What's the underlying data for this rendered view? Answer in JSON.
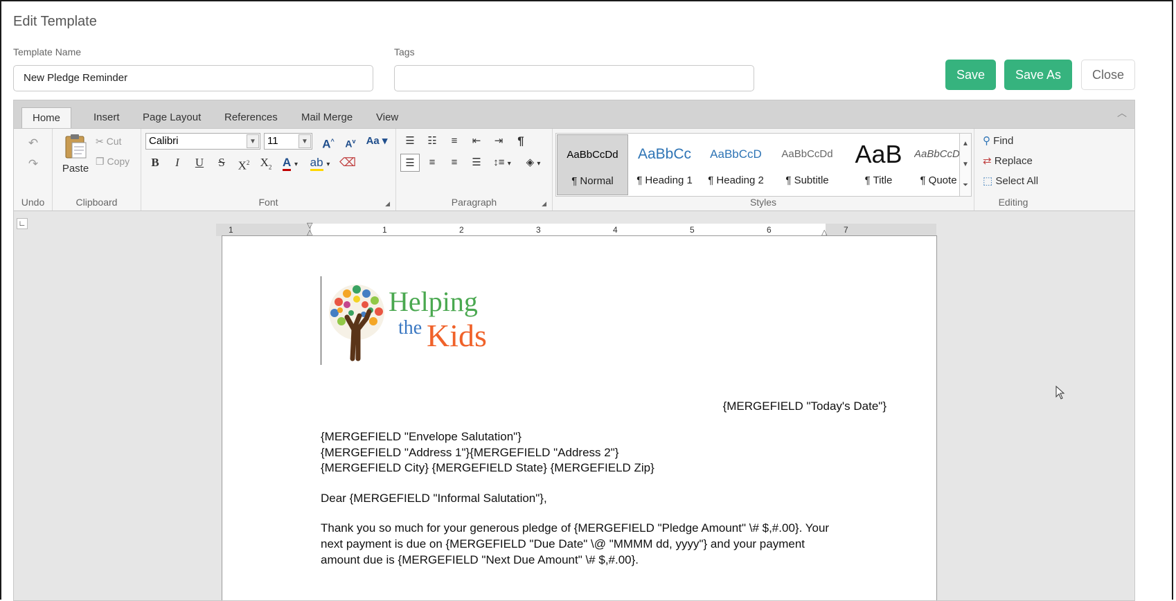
{
  "dialog": {
    "title": "Edit Template"
  },
  "fields": {
    "template_name_label": "Template Name",
    "template_name_value": "New Pledge Reminder",
    "tags_label": "Tags",
    "tags_value": ""
  },
  "buttons": {
    "save": "Save",
    "save_as": "Save As",
    "close": "Close"
  },
  "tabs": [
    "Home",
    "Insert",
    "Page Layout",
    "References",
    "Mail Merge",
    "View"
  ],
  "ribbon": {
    "undo_group": "Undo",
    "clipboard": {
      "group": "Clipboard",
      "paste": "Paste",
      "cut": "Cut",
      "copy": "Copy"
    },
    "font": {
      "group": "Font",
      "name": "Calibri",
      "size": "11"
    },
    "paragraph": {
      "group": "Paragraph"
    },
    "styles": {
      "group": "Styles",
      "items": [
        {
          "preview": "AaBbCcDd",
          "label": "¶ Normal"
        },
        {
          "preview": "AaBbCc",
          "label": "¶ Heading 1"
        },
        {
          "preview": "AaBbCcD",
          "label": "¶ Heading 2"
        },
        {
          "preview": "AaBbCcDd",
          "label": "¶ Subtitle"
        },
        {
          "preview": "AaB",
          "label": "¶ Title"
        },
        {
          "preview": "AaBbCcDd",
          "label": "¶ Quote"
        }
      ]
    },
    "editing": {
      "group": "Editing",
      "find": "Find",
      "replace": "Replace",
      "select_all": "Select All"
    }
  },
  "ruler": {
    "ticks": [
      "1",
      "1",
      "2",
      "3",
      "4",
      "5",
      "6",
      "7"
    ]
  },
  "logo": {
    "line1": "Helping",
    "line2a": "the",
    "line2b": "Kids"
  },
  "document": {
    "date": "{MERGEFIELD \"Today's Date\"}",
    "address": [
      "{MERGEFIELD \"Envelope Salutation\"}",
      "{MERGEFIELD \"Address 1\"}{MERGEFIELD \"Address 2\"}",
      "{MERGEFIELD City} {MERGEFIELD State} {MERGEFIELD Zip}"
    ],
    "greeting": "Dear {MERGEFIELD \"Informal Salutation\"},",
    "body": [
      "Thank you so much for your generous pledge of {MERGEFIELD \"Pledge Amount\" \\# $,#.00}.  Your",
      "next payment is due on {MERGEFIELD \"Due Date\" \\@ \"MMMM dd, yyyy\"} and your payment",
      "amount due is {MERGEFIELD \"Next Due Amount\" \\# $,#.00}."
    ]
  }
}
